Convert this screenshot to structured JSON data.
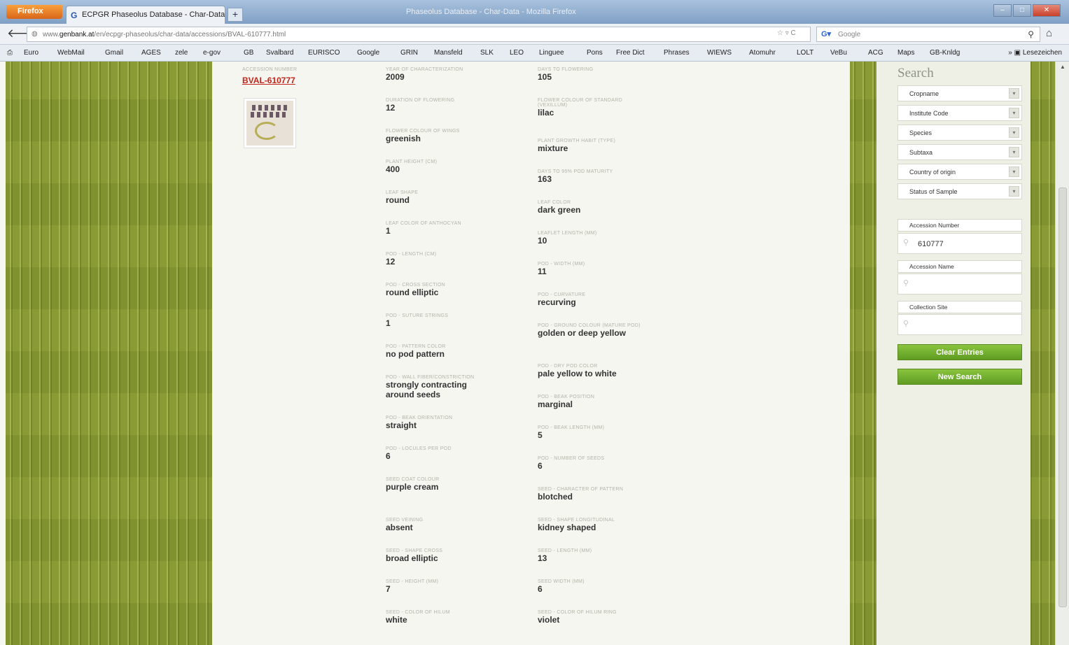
{
  "browser": {
    "app_button": "Firefox",
    "tab_title": "ECPGR Phaseolus Database - Char-Data i...",
    "new_tab": "+",
    "window_title": "Phaseolus Database - Char-Data - Mozilla Firefox",
    "url_prefix": "www.",
    "url_host": "genbank.at",
    "url_path": "/en/ecpgr-phaseolus/char-data/accessions/BVAL-610777.html",
    "search_placeholder": "Google",
    "bookmarks": [
      "Euro",
      "WebMail",
      "Gmail",
      "AGES",
      "zele",
      "e-gov",
      "GB",
      "Svalbard",
      "EURISCO",
      "Google",
      "GRIN",
      "Mansfeld",
      "SLK",
      "LEO",
      "Linguee",
      "Pons",
      "Free Dict",
      "Phrases",
      "WIEWS",
      "Atomuhr",
      "LOLT",
      "VeBu",
      "ACG",
      "Maps",
      "GB-Knldg"
    ],
    "bookmarks_menu": "Lesezeichen"
  },
  "accession": {
    "number_label": "ACCESSION NUMBER",
    "number": "BVAL-610777"
  },
  "fields": [
    {
      "label": "YEAR OF CHARACTERIZATION",
      "value": "2009"
    },
    {
      "label": "DAYS TO FLOWERING",
      "value": "105"
    },
    {
      "label": "DURATION OF FLOWERING",
      "value": "12"
    },
    {
      "label": "FLOWER COLOUR OF STANDARD (VEXILLUM)",
      "value": "lilac"
    },
    {
      "label": "FLOWER COLOUR OF WINGS",
      "value": "greenish"
    },
    {
      "label": "PLANT GROWTH HABIT (TYPE)",
      "value": "mixture"
    },
    {
      "label": "PLANT HEIGHT (CM)",
      "value": "400"
    },
    {
      "label": "DAYS TO 95% POD MATURITY",
      "value": "163"
    },
    {
      "label": "LEAF SHAPE",
      "value": "round"
    },
    {
      "label": "LEAF COLOR",
      "value": "dark green"
    },
    {
      "label": "LEAF COLOR OF ANTHOCYAN",
      "value": "1"
    },
    {
      "label": "LEAFLET LENGTH (MM)",
      "value": "10"
    },
    {
      "label": "POD - LENGTH (CM)",
      "value": "12"
    },
    {
      "label": "POD - WIDTH (MM)",
      "value": "11"
    },
    {
      "label": "POD - CROSS SECTION",
      "value": "round elliptic"
    },
    {
      "label": "POD - CURVATURE",
      "value": "recurving"
    },
    {
      "label": "POD - SUTURE STRINGS",
      "value": "1"
    },
    {
      "label": "POD - GROUND COLOUR (MATURE POD)",
      "value": "golden or deep yellow"
    },
    {
      "label": "POD - PATTERN COLOR",
      "value": "no pod pattern"
    },
    {
      "label": "POD - DRY POD COLOR",
      "value": "pale yellow to white"
    },
    {
      "label": "POD - WALL FIBER/CONSTRICTION",
      "value": "strongly contracting around seeds"
    },
    {
      "label": "POD - BEAK POSITION",
      "value": "marginal"
    },
    {
      "label": "POD - BEAK ORIENTATION",
      "value": "straight"
    },
    {
      "label": "POD - BEAK LENGTH (MM)",
      "value": "5"
    },
    {
      "label": "POD - LOCULES PER POD",
      "value": "6"
    },
    {
      "label": "POD - NUMBER OF SEEDS",
      "value": "6"
    },
    {
      "label": "SEED COAT COLOUR",
      "value": "purple cream"
    },
    {
      "label": "SEED - CHARACTER OF PATTERN",
      "value": "blotched"
    },
    {
      "label": "SEED VEINING",
      "value": "absent"
    },
    {
      "label": "SEED - SHAPE LONGITUDINAL",
      "value": "kidney shaped"
    },
    {
      "label": "SEED - SHAPE CROSS",
      "value": "broad elliptic"
    },
    {
      "label": "SEED - LENGTH (MM)",
      "value": "13"
    },
    {
      "label": "SEED - HEIGHT (MM)",
      "value": "7"
    },
    {
      "label": "SEED WIDTH (MM)",
      "value": "6"
    },
    {
      "label": "SEED - COLOR OF HILUM",
      "value": "white"
    },
    {
      "label": "SEED - COLOR OF HILUM RING",
      "value": "violet"
    }
  ],
  "search": {
    "title": "Search",
    "dropdowns": [
      "Cropname",
      "Institute Code",
      "Species",
      "Subtaxa",
      "Country of origin",
      "Status of Sample"
    ],
    "accession_number_label": "Accession Number",
    "accession_number_value": "610777",
    "accession_name_label": "Accession Name",
    "accession_name_value": "",
    "collection_site_label": "Collection Site",
    "collection_site_value": "",
    "clear_button": "Clear Entries",
    "new_search_button": "New Search"
  },
  "colors": {
    "background_green": "#8a9b36",
    "link_red": "#c0251b",
    "button_green": "#6fae2c"
  }
}
